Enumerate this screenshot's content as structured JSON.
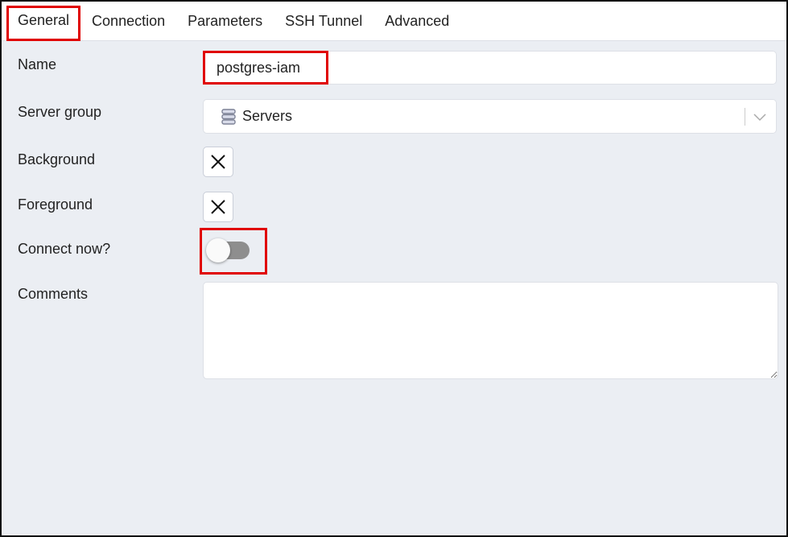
{
  "tabs": [
    {
      "label": "General",
      "active": true
    },
    {
      "label": "Connection"
    },
    {
      "label": "Parameters"
    },
    {
      "label": "SSH Tunnel"
    },
    {
      "label": "Advanced"
    }
  ],
  "form": {
    "name_label": "Name",
    "name_value": "postgres-iam",
    "server_group_label": "Server group",
    "server_group_value": "Servers",
    "server_group_icon": "server-stack-icon",
    "background_label": "Background",
    "background_icon": "x-icon",
    "foreground_label": "Foreground",
    "foreground_icon": "x-icon",
    "connect_now_label": "Connect now?",
    "connect_now": false,
    "comments_label": "Comments",
    "comments_value": ""
  },
  "highlight_color": "#e00000"
}
